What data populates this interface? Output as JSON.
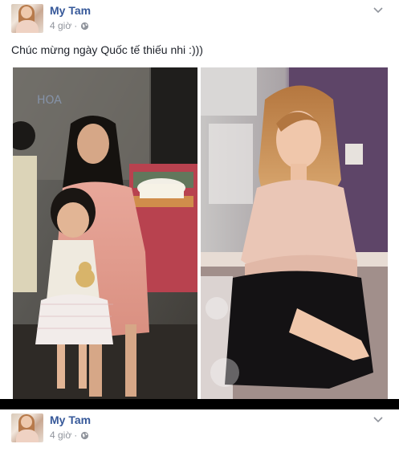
{
  "posts": [
    {
      "author": "My Tam",
      "time": "4 giờ",
      "separator": "·",
      "caption": "Chúc mừng ngày Quốc tế thiếu nhi :)))",
      "audience_icon": "globe-icon",
      "menu_icon": "chevron-down-icon"
    },
    {
      "author": "My Tam",
      "time": "4 giờ",
      "separator": "·",
      "audience_icon": "globe-icon",
      "menu_icon": "chevron-down-icon"
    }
  ],
  "colors": {
    "author_link": "#365899",
    "meta_text": "#90949c",
    "body_text": "#1d2129",
    "separator_bar": "#000000"
  },
  "photos": [
    {
      "name": "childhood-photo",
      "kind": "vintage photograph"
    },
    {
      "name": "portrait-photo",
      "kind": "studio photograph"
    }
  ]
}
